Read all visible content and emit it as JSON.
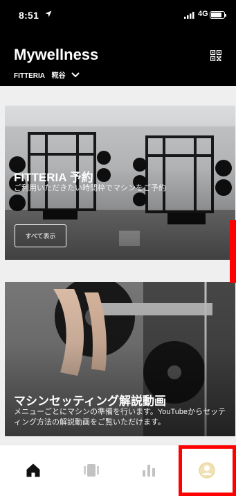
{
  "status_bar": {
    "time": "8:51",
    "network": "4G",
    "icons": [
      "location-arrow-icon",
      "signal-icon",
      "battery-icon"
    ]
  },
  "header": {
    "app_title": "Mywellness",
    "facility": "FITTERIA　糀谷",
    "icons": [
      "chevron-down-icon",
      "qr-code-icon"
    ]
  },
  "cards": [
    {
      "title": "FITTERIA 予約",
      "description": "ご利用いただきたい時間枠でマシンをご予約",
      "button_label": "すべて表示"
    },
    {
      "title": "マシンセッティング解説動画",
      "description": "メニューごとにマシンの準備を行います。YouTubeからセッティング方法の解説動画をご覧いただけます。"
    }
  ],
  "bottom_nav": {
    "items": [
      "home-icon",
      "activity-icon",
      "stats-icon",
      "profile-icon"
    ]
  },
  "colors": {
    "header_bg": "#000000",
    "highlight": "#ff0000",
    "nav_inactive": "#bdbdbd",
    "profile_accent": "#f0e2b4"
  }
}
